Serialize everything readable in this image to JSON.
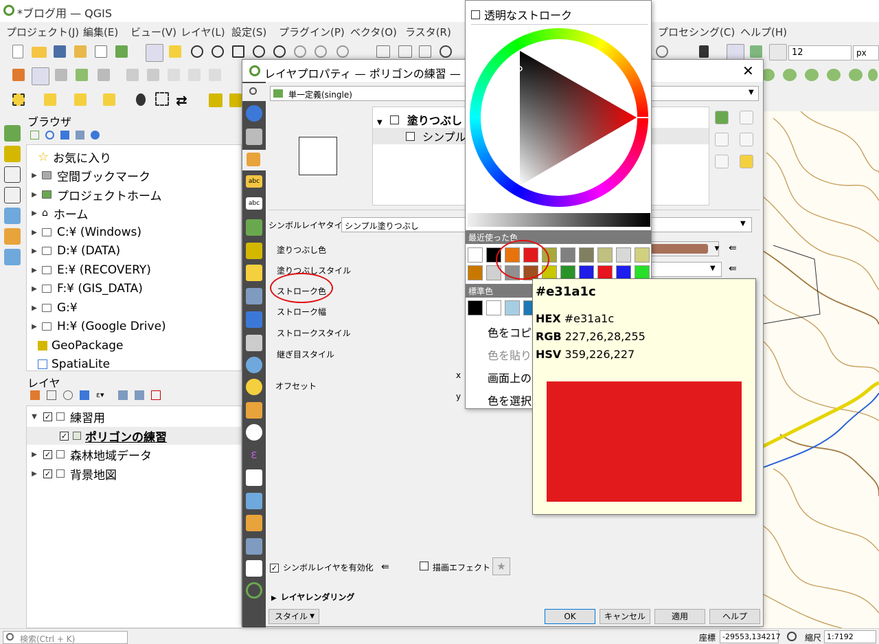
{
  "window": {
    "title": "*ブログ用 — QGIS"
  },
  "menu": [
    "プロジェクト(J)",
    "編集(E)",
    "ビュー(V)",
    "レイヤ(L)",
    "設定(S)",
    "プラグイン(P)",
    "ベクタ(O)",
    "ラスタ(R)",
    "プロセシング(C)",
    "ヘルプ(H)"
  ],
  "toolbar": {
    "size_value": "12",
    "size_unit": "px"
  },
  "browser": {
    "title": "ブラウザ",
    "items": [
      "お気に入り",
      "空間ブックマーク",
      "プロジェクトホーム",
      "ホーム",
      "C:¥ (Windows)",
      "D:¥ (DATA)",
      "E:¥ (RECOVERY)",
      "F:¥ (GIS_DATA)",
      "G:¥",
      "H:¥ (Google Drive)",
      "GeoPackage",
      "SpatiaLite"
    ]
  },
  "layers": {
    "title": "レイヤ",
    "items": [
      "練習用",
      "ポリゴンの練習",
      "森林地域データ",
      "背景地図"
    ]
  },
  "dialog": {
    "title": "レイヤプロパティ — ポリゴンの練習 — シン",
    "renderer": "単一定義(single)",
    "tree_root": "塗りつぶし",
    "tree_child": "シンプル塗",
    "symbol_layer_type_label": "シンボルレイヤタイプ",
    "symbol_layer_type": "シンプル塗りつぶし",
    "props": [
      "塗りつぶし色",
      "塗りつぶしスタイル",
      "ストローク色",
      "ストローク幅",
      "ストロークスタイル",
      "継ぎ目スタイル"
    ],
    "offset_label": "オフセット",
    "x_label": "x",
    "y_label": "y",
    "enable_label": "シンボルレイヤを有効化",
    "effect_label": "描画エフェクト",
    "rendering_label": "レイヤレンダリング",
    "style_button": "スタイル",
    "buttons": {
      "ok": "OK",
      "cancel": "キャンセル",
      "apply": "適用",
      "help": "ヘルプ"
    }
  },
  "colorpicker": {
    "transparent_label": "透明なストローク",
    "recent_label": "最近使った色",
    "standard_label": "標準色",
    "recent_colors": [
      "#ffffff",
      "#000000",
      "#e8730c",
      "#e31a1c",
      "#a8a83c",
      "#808080",
      "#808060",
      "#c0c080",
      "#d8d8d8",
      "#d0d080",
      "#c87800",
      "#d0d0d0",
      "#909090",
      "#a05020",
      "#c8c800",
      "#289428",
      "#1e1ee8",
      "#e8141e",
      "#1e1ef0",
      "#28e028"
    ],
    "standard_colors": [
      "#000000",
      "#ffffff",
      "#a6cee3",
      "#1f78b4"
    ],
    "menu": [
      "色をコピー",
      "色を貼り",
      "画面上の",
      "色を選択"
    ]
  },
  "tooltip": {
    "title": "#e31a1c",
    "hex_label": "HEX",
    "hex": "#e31a1c",
    "rgb_label": "RGB",
    "rgb": "227,26,28,255",
    "hsv_label": "HSV",
    "hsv": "359,226,227",
    "color": "#e31a1c"
  },
  "statusbar": {
    "search_placeholder": "検索(Ctrl + K)",
    "coord_label": "座標",
    "coord": "-29553,134217",
    "scale_label": "縮尺",
    "scale": "1:7192"
  },
  "colors": {
    "fill_color": "#a87058",
    "accent": "#e31a1c"
  }
}
